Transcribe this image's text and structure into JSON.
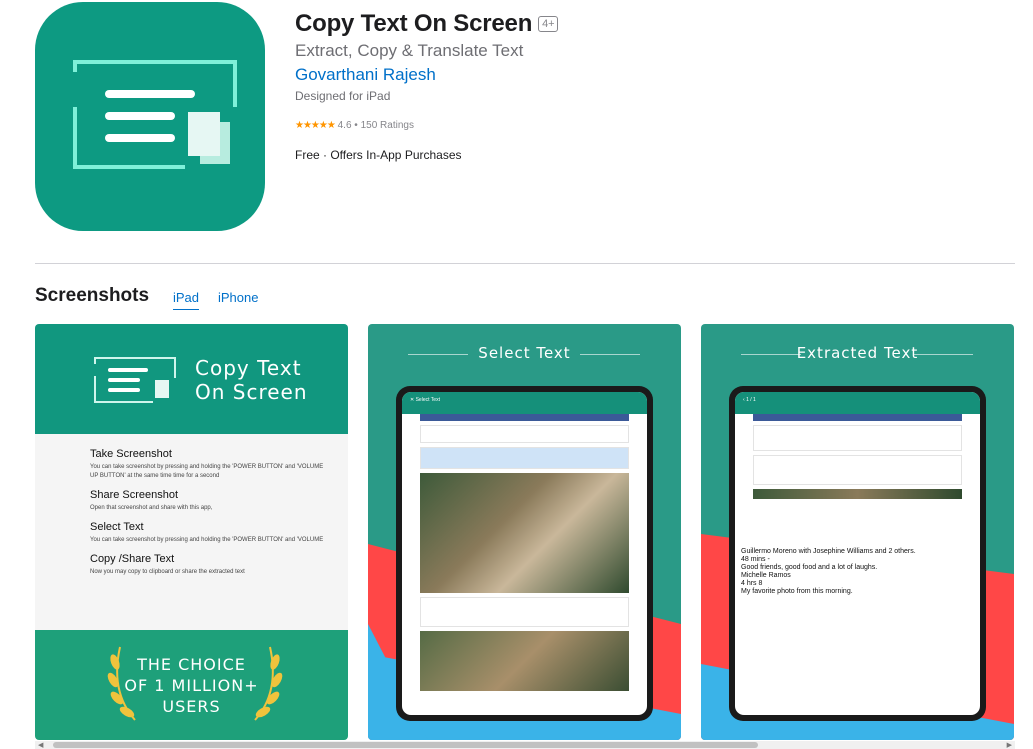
{
  "app": {
    "title": "Copy Text On Screen",
    "age_rating": "4+",
    "subtitle": "Extract, Copy & Translate Text",
    "developer": "Govarthani Rajesh",
    "designed_for": "Designed for iPad",
    "stars": "★★★★★",
    "rating_text": "4.6 • 150 Ratings",
    "price": "Free · Offers In-App Purchases"
  },
  "screenshots": {
    "heading": "Screenshots",
    "tabs": [
      {
        "label": "iPad",
        "active": true
      },
      {
        "label": "iPhone",
        "active": false
      }
    ],
    "shot1": {
      "title_line1": "Copy Text",
      "title_line2": "On Screen",
      "steps": [
        {
          "heading": "Take Screenshot",
          "text": "You can take screenshot by pressing and holding the 'POWER BUTTON' and 'VOLUME UP BUTTON' at the same time time for a second"
        },
        {
          "heading": "Share Screenshot",
          "text": "Open that screenshot and share with this app,"
        },
        {
          "heading": "Select Text",
          "text": "You can take screenshot by pressing and holding the 'POWER BUTTON' and 'VOLUME"
        },
        {
          "heading": "Copy /Share Text",
          "text": "Now you may copy to clipboard or share the extracted text"
        }
      ],
      "choice_line1": "THE CHOICE",
      "choice_line2": "OF 1 MILLION+",
      "choice_line3": "USERS"
    },
    "shot2": {
      "caption": "Select Text",
      "bar_title": "Select Text"
    },
    "shot3": {
      "caption": "Extracted Text",
      "bar_title": "1 / 1",
      "extracted_lines": [
        "Guillermo Moreno with Josephine Williams and 2 others.",
        "48 mins -",
        "Good friends, good food and a lot of laughs.",
        "Michelle Ramos",
        "4 hrs 8",
        "My favorite photo from this morning."
      ]
    }
  },
  "colors": {
    "accent": "#0070c9",
    "brand": "#0d9a82",
    "stars": "#ff9500"
  }
}
